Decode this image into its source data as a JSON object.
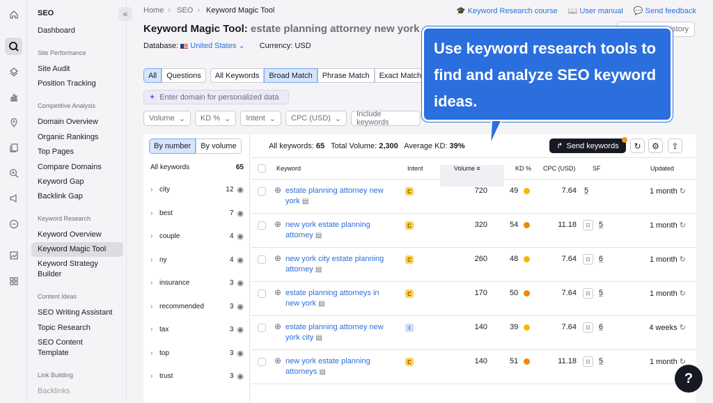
{
  "sidebar": {
    "title": "SEO",
    "dashboard": "Dashboard",
    "sections": [
      {
        "title": "Site Performance",
        "items": [
          "Site Audit",
          "Position Tracking"
        ]
      },
      {
        "title": "Competitive Analysis",
        "items": [
          "Domain Overview",
          "Organic Rankings",
          "Top Pages",
          "Compare Domains",
          "Keyword Gap",
          "Backlink Gap"
        ]
      },
      {
        "title": "Keyword Research",
        "items": [
          "Keyword Overview",
          "Keyword Magic Tool",
          "Keyword Strategy Builder"
        ]
      },
      {
        "title": "Content Ideas",
        "items": [
          "SEO Writing Assistant",
          "Topic Research",
          "SEO Content Template"
        ]
      },
      {
        "title": "Link Building",
        "items": [
          "Backlinks"
        ]
      }
    ],
    "active": "Keyword Magic Tool"
  },
  "breadcrumb": [
    "Home",
    "SEO",
    "Keyword Magic Tool"
  ],
  "toplinks": [
    "Keyword Research course",
    "User manual",
    "Send feedback"
  ],
  "title": {
    "tool": "Keyword Magic Tool:",
    "query": "estate planning attorney new york"
  },
  "database": {
    "label": "Database:",
    "value": "United States",
    "currency": "Currency: USD"
  },
  "history_button": "istory",
  "tabs": {
    "group1": [
      "All",
      "Questions"
    ],
    "group2": [
      "All Keywords",
      "Broad Match",
      "Phrase Match",
      "Exact Match"
    ]
  },
  "domain_placeholder": "Enter domain for personalized data",
  "filters": [
    "Volume",
    "KD %",
    "Intent",
    "CPC (USD)",
    "Include keywords"
  ],
  "left_panel": {
    "toggle": [
      "By number",
      "By volume"
    ],
    "all_label": "All keywords",
    "all_count": "65",
    "groups": [
      {
        "name": "city",
        "count": "12"
      },
      {
        "name": "best",
        "count": "7"
      },
      {
        "name": "couple",
        "count": "4"
      },
      {
        "name": "ny",
        "count": "4"
      },
      {
        "name": "insurance",
        "count": "3"
      },
      {
        "name": "recommended",
        "count": "3"
      },
      {
        "name": "tax",
        "count": "3"
      },
      {
        "name": "top",
        "count": "3"
      },
      {
        "name": "trust",
        "count": "3"
      }
    ]
  },
  "stats": {
    "all_label": "All keywords:",
    "all": "65",
    "vol_label": "Total Volume:",
    "vol": "2,300",
    "kd_label": "Average KD:",
    "kd": "39%"
  },
  "send_button": "Send keywords",
  "columns": [
    "Keyword",
    "Intent",
    "Volume",
    "KD %",
    "CPC (USD)",
    "SF",
    "Updated"
  ],
  "rows": [
    {
      "kw1": "estate planning attorney new",
      "kw2": "york",
      "intent": "C",
      "volume": "720",
      "kd": "49",
      "kd_color": "#f5b800",
      "cpc": "7.64",
      "sf": "5",
      "sf_icon": false,
      "updated": "1 month"
    },
    {
      "kw1": "new york estate planning",
      "kw2": "attorney",
      "intent": "C",
      "volume": "320",
      "kd": "54",
      "kd_color": "#f28705",
      "cpc": "11.18",
      "sf": "5",
      "sf_icon": true,
      "updated": "1 month"
    },
    {
      "kw1": "new york city estate planning",
      "kw2": "attorney",
      "intent": "C",
      "volume": "260",
      "kd": "48",
      "kd_color": "#f5b800",
      "cpc": "7.64",
      "sf": "6",
      "sf_icon": true,
      "updated": "1 month"
    },
    {
      "kw1": "estate planning attorneys in",
      "kw2": "new york",
      "intent": "C",
      "volume": "170",
      "kd": "50",
      "kd_color": "#f28705",
      "cpc": "7.64",
      "sf": "5",
      "sf_icon": true,
      "updated": "1 month"
    },
    {
      "kw1": "estate planning attorney new",
      "kw2": "york city",
      "intent": "I",
      "volume": "140",
      "kd": "39",
      "kd_color": "#f5b800",
      "cpc": "7.64",
      "sf": "6",
      "sf_icon": true,
      "updated": "4 weeks"
    },
    {
      "kw1": "new york estate planning",
      "kw2": "attorneys",
      "intent": "C",
      "volume": "140",
      "kd": "51",
      "kd_color": "#f28705",
      "cpc": "11.18",
      "sf": "5",
      "sf_icon": true,
      "updated": "1 month"
    }
  ],
  "callout": "Use keyword research tools to find and analyze SEO keyword ideas.",
  "help": "?"
}
